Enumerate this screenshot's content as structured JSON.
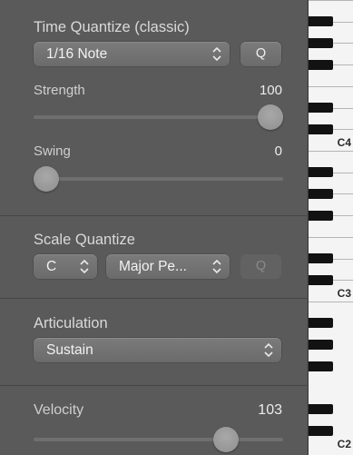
{
  "time_quantize": {
    "title": "Time Quantize (classic)",
    "note_value": "1/16 Note",
    "q_label": "Q",
    "strength_label": "Strength",
    "strength_value": "100",
    "strength_fraction": 1.0,
    "swing_label": "Swing",
    "swing_value": "0",
    "swing_fraction": 0.0
  },
  "scale_quantize": {
    "title": "Scale Quantize",
    "root": "C",
    "scale": "Major Pe...",
    "q_label": "Q"
  },
  "articulation": {
    "title": "Articulation",
    "value": "Sustain"
  },
  "velocity": {
    "label": "Velocity",
    "value": "103",
    "fraction": 0.8
  },
  "keyboard": {
    "labels": [
      "C4",
      "C3",
      "C2"
    ]
  }
}
